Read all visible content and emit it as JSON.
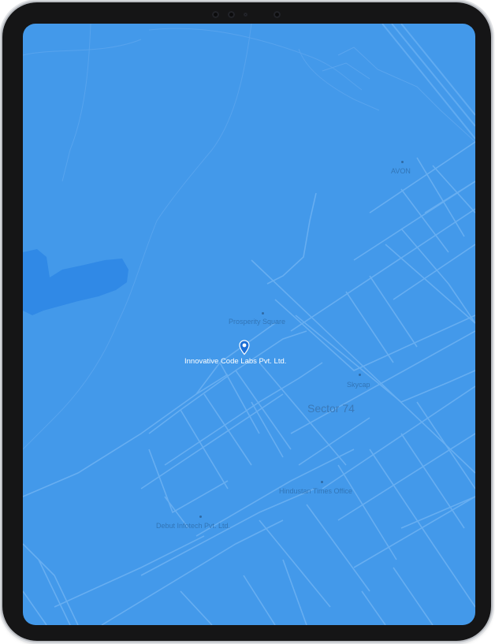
{
  "map": {
    "labels": {
      "avon": "AVON",
      "prosperity_square": "Prosperity Square",
      "innovative_code_labs": "Innovative Code Labs Pvt. Ltd.",
      "skycap": "Skycap",
      "sector_74": "Sector 74",
      "hindustan_times_office": "Hindustan Times Office",
      "debut_infotech": "Debut Infotech Pvt. Ltd."
    },
    "marker_icon": "location-pin-icon",
    "colors": {
      "map_background": "#4399ea",
      "road_stroke": "#6aaff0",
      "water": "#3089e6",
      "marker": "#1d6fd6",
      "device_frame": "#151516"
    }
  }
}
